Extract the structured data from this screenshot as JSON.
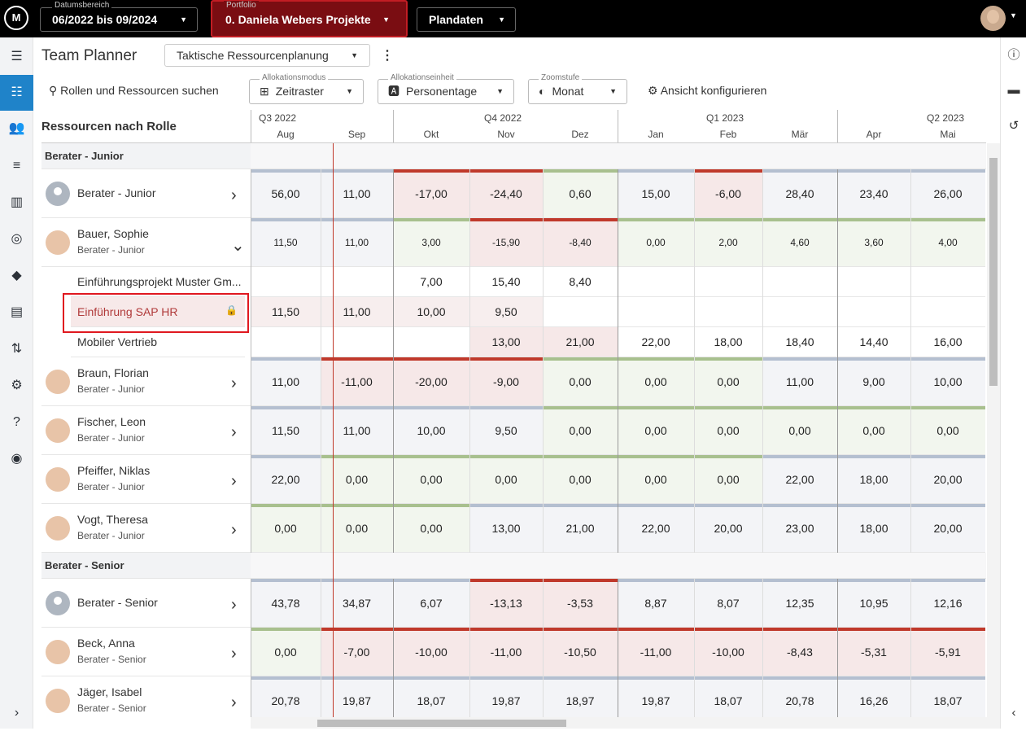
{
  "topbar": {
    "date_range": {
      "label": "Datumsbereich",
      "value": "06/2022 bis 09/2024"
    },
    "portfolio": {
      "label": "Portfolio",
      "value": "0. Daniela Webers Projekte"
    },
    "mode": {
      "value": "Plandaten"
    }
  },
  "header": {
    "title": "Team Planner",
    "view": "Taktische Ressourcenplanung"
  },
  "toolbar": {
    "search": "Rollen und Ressourcen suchen",
    "alloc_mode": {
      "label": "Allokationsmodus",
      "value": "Zeitraster"
    },
    "alloc_unit": {
      "label": "Allokationseinheit",
      "value": "Personentage"
    },
    "zoom": {
      "label": "Zoomstufe",
      "value": "Monat"
    },
    "configure": "Ansicht konfigurieren"
  },
  "grid": {
    "left_header": "Ressourcen nach Rolle",
    "quarters": [
      "Q3 2022",
      "Q4 2022",
      "Q1 2023",
      "Q2 2023"
    ],
    "months": [
      "Aug",
      "Sep",
      "Okt",
      "Nov",
      "Dez",
      "Jan",
      "Feb",
      "Mär",
      "Apr",
      "Mai"
    ],
    "groups": [
      {
        "name": "Berater - Junior"
      },
      {
        "name": "Berater - Senior"
      }
    ],
    "rows": [
      {
        "name": "Berater - Junior",
        "values": [
          "56,00",
          "11,00",
          "-17,00",
          "-24,40",
          "0,60",
          "15,00",
          "-6,00",
          "28,40",
          "23,40",
          "26,00"
        ]
      },
      {
        "name": "Bauer, Sophie",
        "sub": "Berater - Junior",
        "values": [
          "11,50",
          "11,00",
          "3,00",
          "-15,90",
          "-8,40",
          "0,00",
          "2,00",
          "4,60",
          "3,60",
          "4,00"
        ]
      },
      {
        "project": "Einführungsprojekt Muster Gm...",
        "values": [
          "",
          "",
          "7,00",
          "15,40",
          "8,40",
          "",
          "",
          "",
          "",
          ""
        ]
      },
      {
        "project": "Einführung SAP HR",
        "values": [
          "11,50",
          "11,00",
          "10,00",
          "9,50",
          "",
          "",
          "",
          "",
          "",
          ""
        ]
      },
      {
        "project": "Mobiler Vertrieb",
        "values": [
          "",
          "",
          "",
          "13,00",
          "21,00",
          "22,00",
          "18,00",
          "18,40",
          "14,40",
          "16,00"
        ]
      },
      {
        "name": "Braun, Florian",
        "sub": "Berater - Junior",
        "values": [
          "11,00",
          "-11,00",
          "-20,00",
          "-9,00",
          "0,00",
          "0,00",
          "0,00",
          "11,00",
          "9,00",
          "10,00"
        ]
      },
      {
        "name": "Fischer, Leon",
        "sub": "Berater - Junior",
        "values": [
          "11,50",
          "11,00",
          "10,00",
          "9,50",
          "0,00",
          "0,00",
          "0,00",
          "0,00",
          "0,00",
          "0,00"
        ]
      },
      {
        "name": "Pfeiffer, Niklas",
        "sub": "Berater - Junior",
        "values": [
          "22,00",
          "0,00",
          "0,00",
          "0,00",
          "0,00",
          "0,00",
          "0,00",
          "22,00",
          "18,00",
          "20,00"
        ]
      },
      {
        "name": "Vogt, Theresa",
        "sub": "Berater - Junior",
        "values": [
          "0,00",
          "0,00",
          "0,00",
          "13,00",
          "21,00",
          "22,00",
          "20,00",
          "23,00",
          "18,00",
          "20,00"
        ]
      },
      {
        "name": "Berater - Senior",
        "values": [
          "43,78",
          "34,87",
          "6,07",
          "-13,13",
          "-3,53",
          "8,87",
          "8,07",
          "12,35",
          "10,95",
          "12,16"
        ]
      },
      {
        "name": "Beck, Anna",
        "sub": "Berater - Senior",
        "values": [
          "0,00",
          "-7,00",
          "-10,00",
          "-11,00",
          "-10,50",
          "-11,00",
          "-10,00",
          "-8,43",
          "-5,31",
          "-5,91"
        ]
      },
      {
        "name": "Jäger, Isabel",
        "sub": "Berater - Senior",
        "values": [
          "20,78",
          "19,87",
          "18,07",
          "19,87",
          "18,97",
          "19,87",
          "18,07",
          "20,78",
          "16,26",
          "18,07"
        ]
      }
    ]
  },
  "colors": {
    "accent": "#1f83c9",
    "over": "#c0392b",
    "under": "#a8c08e",
    "neutral": "#b4bfd0"
  }
}
